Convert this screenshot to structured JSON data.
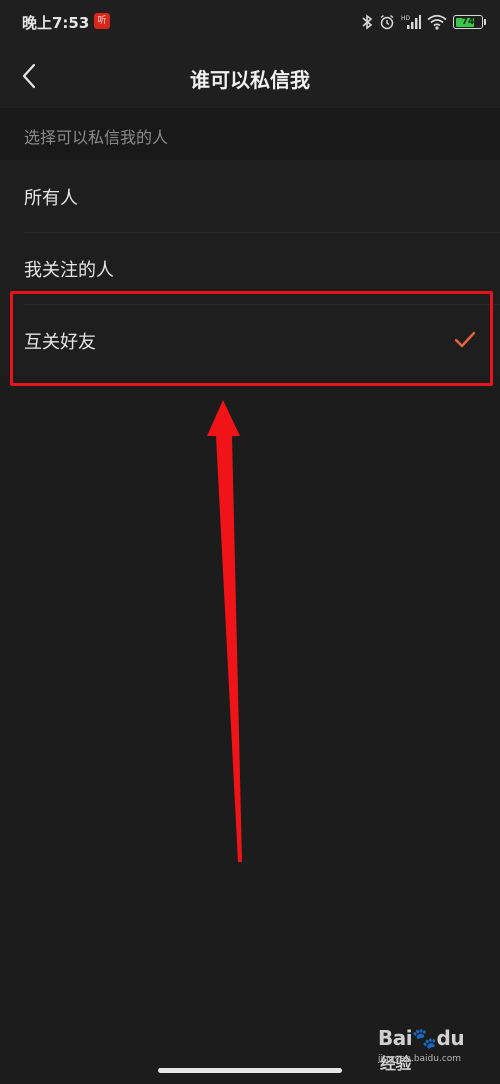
{
  "status_bar": {
    "time": "晚上7:53",
    "badge": "听",
    "battery_level": 74,
    "battery_text": "74",
    "signal_label": "HD",
    "colors": {
      "battery_fill": "#3bc54a",
      "badge": "#d7261c"
    }
  },
  "header": {
    "back_icon": "chevron-left-icon",
    "title": "谁可以私信我"
  },
  "section": {
    "title": "选择可以私信我的人"
  },
  "options": [
    {
      "label": "所有人",
      "selected": false
    },
    {
      "label": "我关注的人",
      "selected": false
    },
    {
      "label": "互关好友",
      "selected": true,
      "check_icon": "checkmark-icon"
    }
  ],
  "colors": {
    "accent": "#e8623a",
    "annotation": "#e8141c",
    "background": "#1c1c1c"
  },
  "watermark": {
    "logo": "Bai",
    "logo_suffix": "du",
    "brand": "经验",
    "url": "jingyan.baidu.com"
  }
}
